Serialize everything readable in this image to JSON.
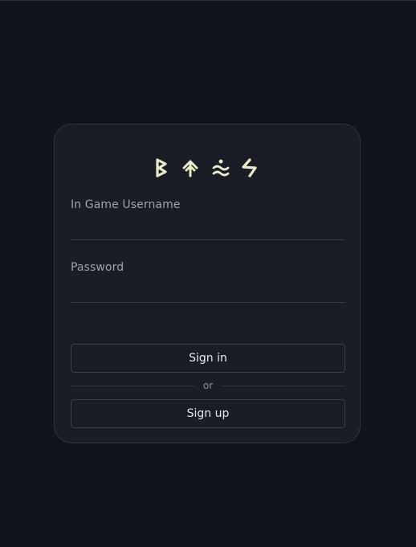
{
  "logo": {
    "glyph_color": "#e8ecc8",
    "icons": [
      "rune-berkana-icon",
      "rune-tiwaz-arrows-icon",
      "rune-waves-icon",
      "rune-sowilo-icon"
    ]
  },
  "form": {
    "username_label": "In Game Username",
    "username_value": "",
    "password_label": "Password",
    "password_value": "",
    "signin_label": "Sign in",
    "or_label": "or",
    "signup_label": "Sign up"
  },
  "colors": {
    "background": "#11141d",
    "card": "#1a1d26",
    "border": "#2f333e"
  }
}
